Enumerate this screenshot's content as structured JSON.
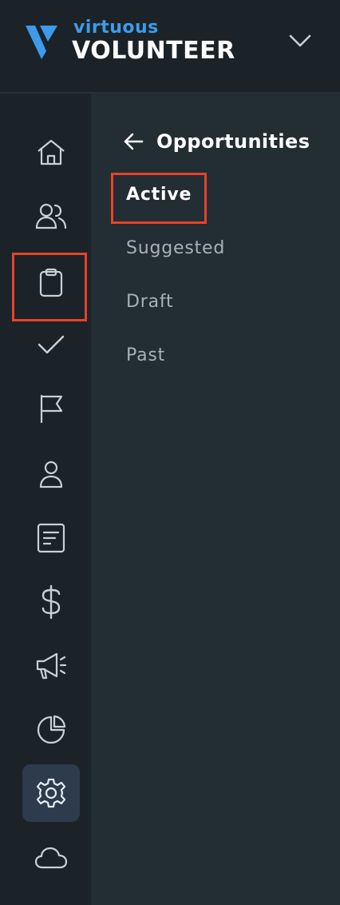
{
  "brand": {
    "small": "virtuous",
    "big": "VOLUNTEER",
    "accent_color": "#3d9be9",
    "mark_color": "#3d9be9"
  },
  "header": {
    "expand_icon": "chevron-down-icon"
  },
  "rail": {
    "items": [
      {
        "icon": "home-icon"
      },
      {
        "icon": "users-icon"
      },
      {
        "icon": "clipboard-icon"
      },
      {
        "icon": "check-icon"
      },
      {
        "icon": "flag-icon"
      },
      {
        "icon": "user-icon"
      },
      {
        "icon": "document-icon"
      },
      {
        "icon": "dollar-icon"
      },
      {
        "icon": "megaphone-icon"
      },
      {
        "icon": "pie-chart-icon"
      },
      {
        "icon": "gear-icon",
        "selected": true
      },
      {
        "icon": "cloud-icon"
      }
    ]
  },
  "panel": {
    "title": "Opportunities",
    "back_icon": "arrow-left-icon",
    "items": [
      {
        "label": "Active",
        "active": true
      },
      {
        "label": "Suggested"
      },
      {
        "label": "Draft"
      },
      {
        "label": "Past"
      }
    ]
  },
  "colors": {
    "highlight": "#e8422a",
    "selected_bg": "#2d3b4d"
  }
}
